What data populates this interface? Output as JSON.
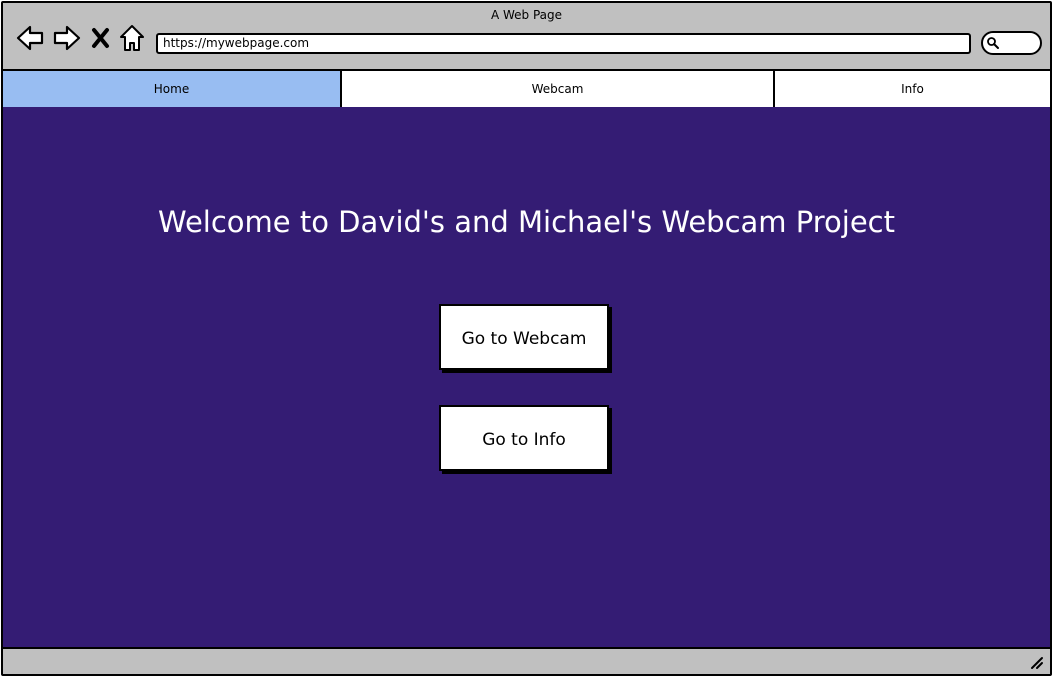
{
  "window": {
    "title": "A Web Page"
  },
  "toolbar": {
    "icons": [
      "back-arrow-icon",
      "forward-arrow-icon",
      "close-icon",
      "home-icon"
    ],
    "url": "https://mywebpage.com",
    "search_icon": "search-icon"
  },
  "tabs": [
    {
      "label": "Home",
      "active": true
    },
    {
      "label": "Webcam",
      "active": false
    },
    {
      "label": "Info",
      "active": false
    }
  ],
  "main": {
    "headline": "Welcome to David's and Michael's Webcam Project",
    "buttons": {
      "webcam": "Go to Webcam",
      "info": "Go to Info"
    }
  },
  "colors": {
    "background": "#341c74",
    "active_tab": "#98bdf2",
    "chrome": "#c0c0c0"
  }
}
